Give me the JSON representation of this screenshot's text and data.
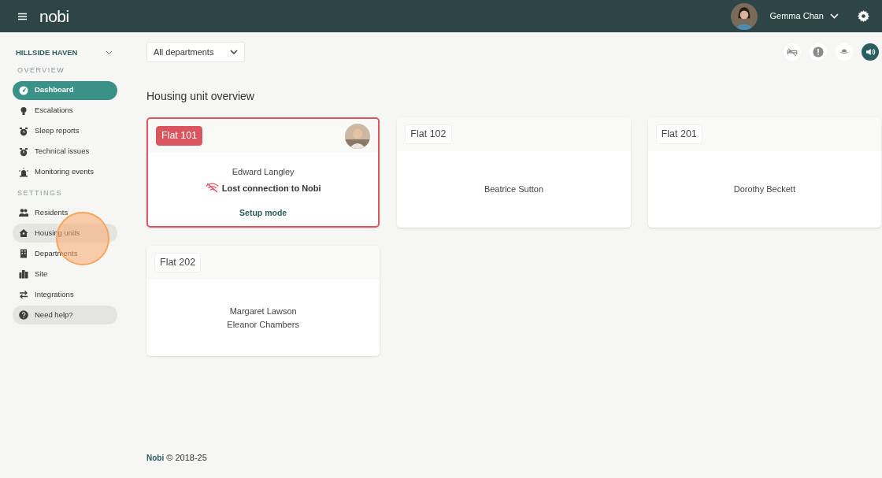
{
  "header": {
    "logo": "nobi",
    "user_name": "Gemma Chan"
  },
  "sidebar": {
    "site": "HILLSIDE HAVEN",
    "sections": [
      {
        "title": "OVERVIEW",
        "items": [
          {
            "label": "Dashboard",
            "selected": true,
            "highlighted": false
          },
          {
            "label": "Escalations",
            "selected": false,
            "highlighted": false
          },
          {
            "label": "Sleep reports",
            "selected": false,
            "highlighted": false
          },
          {
            "label": "Technical issues",
            "selected": false,
            "highlighted": false
          },
          {
            "label": "Monitoring events",
            "selected": false,
            "highlighted": false
          }
        ]
      },
      {
        "title": "SETTINGS",
        "items": [
          {
            "label": "Residents",
            "selected": false,
            "highlighted": false
          },
          {
            "label": "Housing units",
            "selected": false,
            "highlighted": true
          },
          {
            "label": "Departments",
            "selected": false,
            "highlighted": false
          },
          {
            "label": "Site",
            "selected": false,
            "highlighted": false
          },
          {
            "label": "Integrations",
            "selected": false,
            "highlighted": false
          },
          {
            "label": "Need help?",
            "selected": false,
            "highlighted": true
          }
        ]
      }
    ]
  },
  "toolbar": {
    "department_filter": "All departments",
    "status_icons": [
      {
        "on": false
      },
      {
        "on": false
      },
      {
        "on": false
      },
      {
        "on": true
      }
    ]
  },
  "title": "Housing unit overview",
  "units": [
    {
      "name": "Flat 101",
      "alert": true,
      "photo": true,
      "residents": [
        "Edward Langley"
      ],
      "status": "Lost connection to Nobi",
      "action": "Setup mode"
    },
    {
      "name": "Flat 102",
      "alert": false,
      "photo": false,
      "residents": [
        "Beatrice Sutton"
      ]
    },
    {
      "name": "Flat 201",
      "alert": false,
      "photo": false,
      "residents": [
        "Dorothy Beckett"
      ]
    },
    {
      "name": "Flat 202",
      "alert": false,
      "photo": false,
      "residents": [
        "Margaret Lawson",
        "Eleanor Chambers"
      ]
    }
  ],
  "footer": {
    "brand": "Nobi",
    "text": "© 2018-25"
  }
}
